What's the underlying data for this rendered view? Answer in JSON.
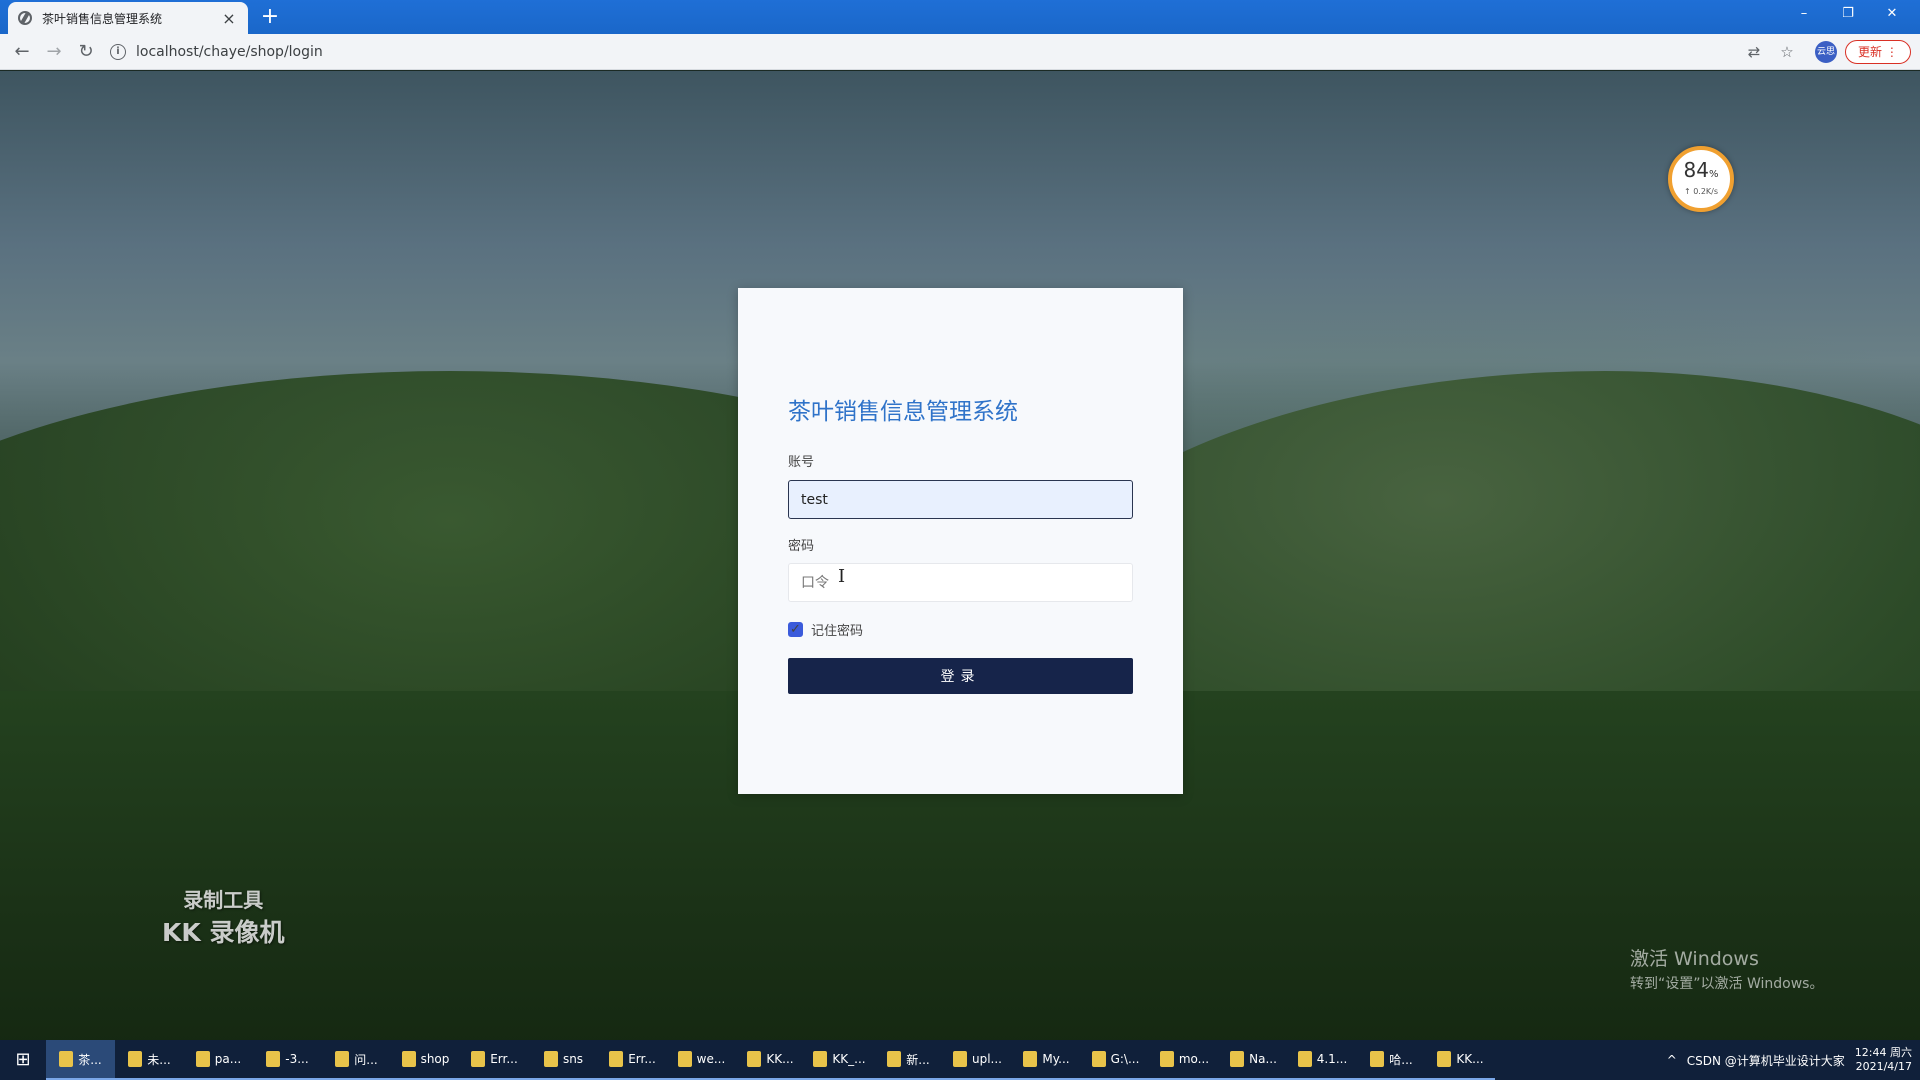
{
  "browser": {
    "tab_title": "茶叶销售信息管理系统",
    "tab_close": "×",
    "new_tab": "+",
    "url": "localhost/chaye/shop/login",
    "profile_label": "云思",
    "update_label": "更新",
    "window_controls": [
      "–",
      "❐",
      "✕"
    ]
  },
  "speed_widget": {
    "percent": "84",
    "percent_unit": "%",
    "rate": "↑ 0.2K/s"
  },
  "login": {
    "title": "茶叶销售信息管理系统",
    "account_label": "账号",
    "account_value": "test",
    "password_label": "密码",
    "password_placeholder": "口令",
    "remember_label": "记住密码",
    "remember_checked": true,
    "submit_label": "登录"
  },
  "watermarks": {
    "recorder_line1": "录制工具",
    "recorder_line2": "KK 录像机",
    "activate_line1": "激活 Windows",
    "activate_line2": "转到“设置”以激活 Windows。"
  },
  "taskbar": {
    "items": [
      {
        "label": "茶..."
      },
      {
        "label": "未..."
      },
      {
        "label": "pa..."
      },
      {
        "label": "-3..."
      },
      {
        "label": "问..."
      },
      {
        "label": "shop"
      },
      {
        "label": "Err..."
      },
      {
        "label": "sns"
      },
      {
        "label": "Err..."
      },
      {
        "label": "we..."
      },
      {
        "label": "KK..."
      },
      {
        "label": "KK_..."
      },
      {
        "label": "新..."
      },
      {
        "label": "upl..."
      },
      {
        "label": "My..."
      },
      {
        "label": "G:\\..."
      },
      {
        "label": "mo..."
      },
      {
        "label": "Na..."
      },
      {
        "label": "4.1..."
      },
      {
        "label": "哈..."
      },
      {
        "label": "KK..."
      }
    ],
    "tray_text": "CSDN @计算机毕业设计大家",
    "time": "12:44 周六",
    "date": "2021/4/17"
  },
  "colors": {
    "title_blue": "#2f73c9",
    "button_navy": "#16244a",
    "checkbox_blue": "#3b5bdb"
  }
}
